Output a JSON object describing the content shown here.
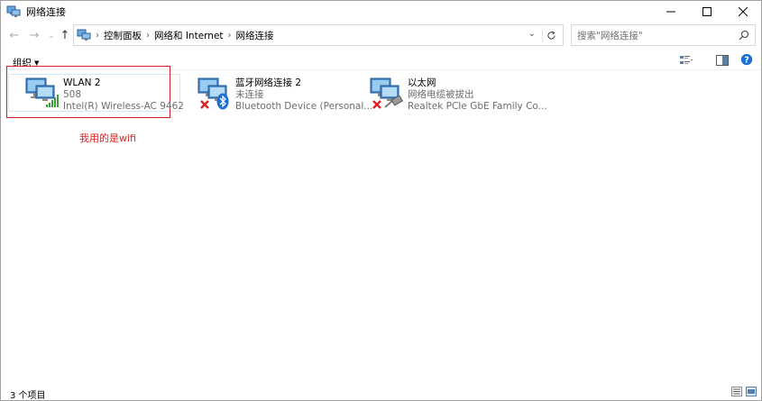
{
  "window": {
    "title": "网络连接",
    "controls": {
      "minimize": "minimize",
      "maximize": "maximize",
      "close": "close"
    }
  },
  "address": {
    "breadcrumbs": [
      "控制面板",
      "网络和 Internet",
      "网络连接"
    ]
  },
  "search": {
    "placeholder": "搜索\"网络连接\""
  },
  "toolbar": {
    "organize_label": "组织"
  },
  "items": [
    {
      "name": "WLAN 2",
      "status": "508",
      "device": "Intel(R) Wireless-AC 9462",
      "icon": "wifi-signal-icon"
    },
    {
      "name": "蓝牙网络连接 2",
      "status": "未连接",
      "device": "Bluetooth Device (Personal...",
      "icon": "bluetooth-icon"
    },
    {
      "name": "以太网",
      "status": "网络电缆被拔出",
      "device": "Realtek PCIe GbE Family Co...",
      "icon": "ethernet-cable-icon"
    }
  ],
  "annotation": {
    "text": "我用的是wifi",
    "color": "#e02020"
  },
  "statusbar": {
    "count": "3 个项目"
  },
  "colors": {
    "accent": "#0078d7",
    "help": "#1a6fd6",
    "annotation": "#e02020",
    "signal": "#3aa13a"
  }
}
